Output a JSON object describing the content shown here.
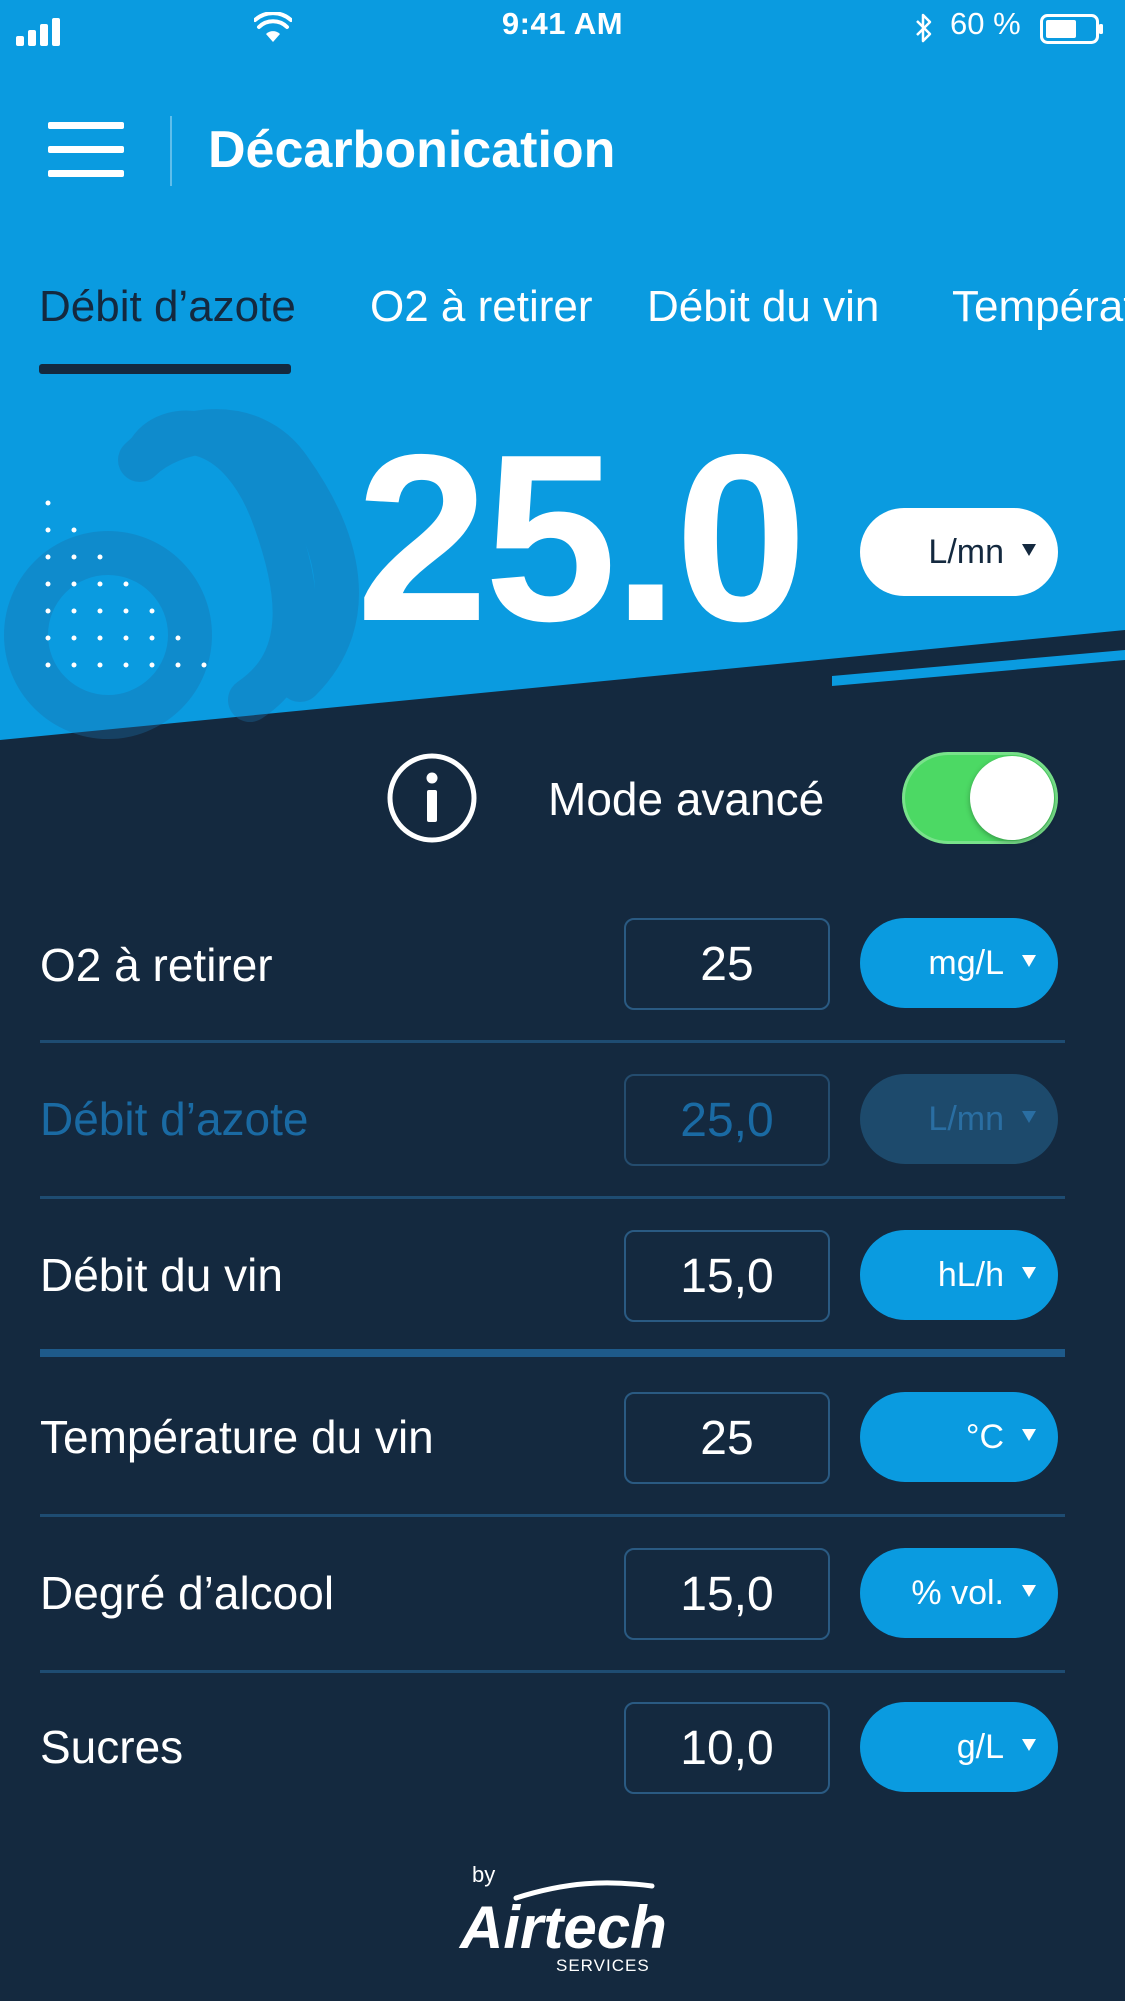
{
  "status_bar": {
    "time": "9:41 AM",
    "battery": "60 %"
  },
  "header": {
    "title": "Décarbonication"
  },
  "tabs": [
    {
      "label": "Débit d’azote",
      "active": true
    },
    {
      "label": "O2 à retirer",
      "active": false
    },
    {
      "label": "Débit du vin",
      "active": false
    },
    {
      "label": "Températ",
      "active": false
    }
  ],
  "main_value": {
    "value": "25.0",
    "unit": "L/mn"
  },
  "advanced_mode": {
    "label": "Mode avancé",
    "enabled": true
  },
  "parameters": [
    {
      "label": "O2 à retirer",
      "value": "25",
      "unit": "mg/L",
      "disabled": false
    },
    {
      "label": "Débit d’azote",
      "value": "25,0",
      "unit": "L/mn",
      "disabled": true
    },
    {
      "label": "Débit du vin",
      "value": "15,0",
      "unit": "hL/h",
      "disabled": false
    },
    {
      "label": "Température du vin",
      "value": "25",
      "unit": "°C",
      "disabled": false
    },
    {
      "label": "Degré d’alcool",
      "value": "15,0",
      "unit": "% vol.",
      "disabled": false
    },
    {
      "label": "Sucres",
      "value": "10,0",
      "unit": "g/L",
      "disabled": false
    }
  ],
  "footer": {
    "by": "by",
    "brand": "Airtech",
    "brand_sub": "SERVICES"
  },
  "colors": {
    "primary_blue": "#0a9be0",
    "navy": "#14293f",
    "toggle_green": "#4cd964"
  }
}
